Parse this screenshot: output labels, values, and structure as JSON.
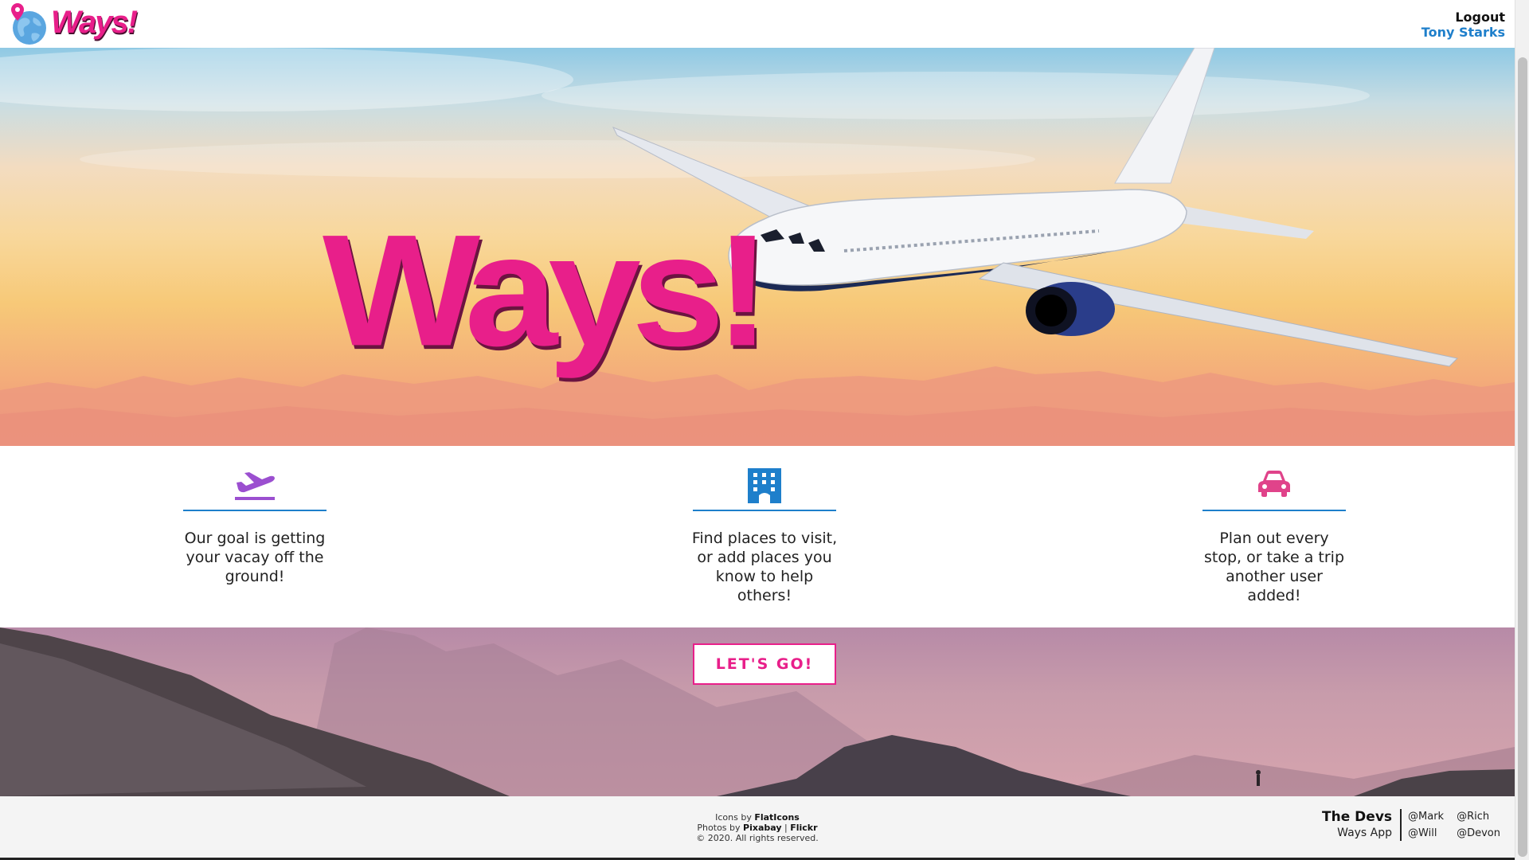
{
  "header": {
    "logo_text": "Ways!",
    "logout_label": "Logout",
    "user_name": "Tony Starks"
  },
  "hero": {
    "title": "Ways!"
  },
  "features": [
    {
      "icon": "airplane-takeoff-icon",
      "color": "#9b4fd0",
      "text": "Our goal is getting your vacay off the ground!"
    },
    {
      "icon": "building-icon",
      "color": "#1e7fcb",
      "text": "Find places to visit, or add places you know to help others!"
    },
    {
      "icon": "car-icon",
      "color": "#e0438a",
      "text": "Plan out every stop, or take a trip another user added!"
    }
  ],
  "cta": {
    "label": "LET'S GO!"
  },
  "footer": {
    "credits": {
      "icons_prefix": "Icons by",
      "icons_source": "FlatIcons",
      "photos_prefix": "Photos by",
      "photos_source1": "Pixabay",
      "separator": "|",
      "photos_source2": "Flickr",
      "copyright": "© 2020. All rights reserved."
    },
    "devs": {
      "title": "The Devs",
      "app": "Ways App",
      "handles": [
        "@Mark",
        "@Rich",
        "@Will",
        "@Devon"
      ]
    }
  },
  "colors": {
    "brand_pink": "#e81f8a",
    "accent_blue": "#1e7fcb"
  }
}
